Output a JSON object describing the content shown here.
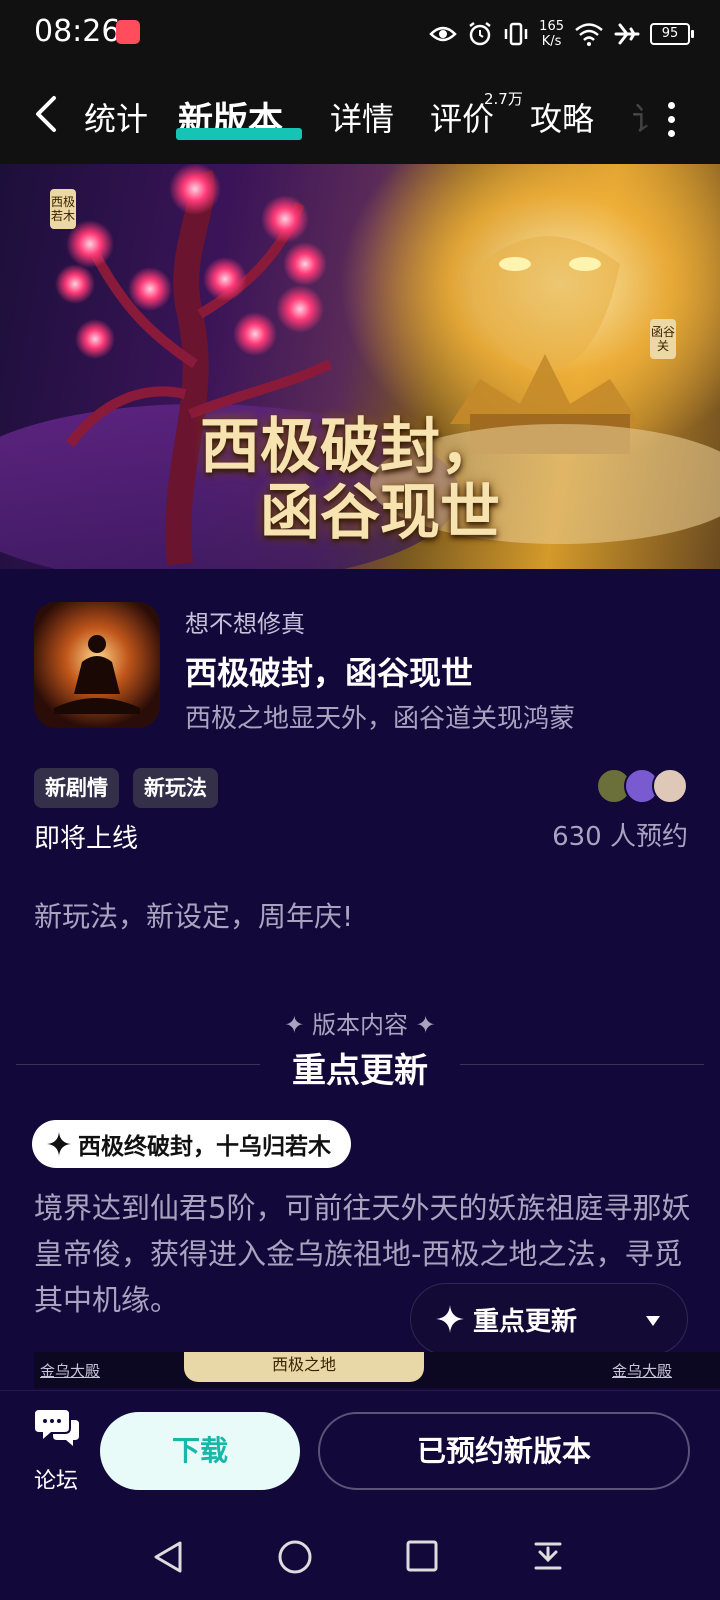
{
  "status_bar": {
    "time": "08:26",
    "net_speed_value": "165",
    "net_speed_unit": "K/s",
    "battery": "95"
  },
  "tabs": {
    "items": [
      "统计",
      "新版本",
      "详情",
      "评价",
      "攻略",
      "讠"
    ],
    "active_index": 1,
    "review_badge": "2.7万",
    "accent_color": "#16c4b4"
  },
  "banner": {
    "title_line1": "西极破封，",
    "title_line2": "函谷现世",
    "tag_left": "西极若木",
    "tag_right": "函谷关"
  },
  "version": {
    "game_name": "想不想修真",
    "title": "西极破封，函谷现世",
    "subtitle": "西极之地显天外，函谷道关现鸿蒙",
    "tags": [
      "新剧情",
      "新玩法"
    ],
    "status": "即将上线",
    "reserve_count": "630 人预约",
    "description": "新玩法，新设定，周年庆!"
  },
  "section": {
    "kicker": "✦ 版本内容 ✦",
    "title": "重点更新",
    "highlight_title": "西极终破封，十乌归若木",
    "body": "境界达到仙君5阶，可前往天外天的妖族祖庭寻那妖皇帝俊，获得进入金乌族祖地-西极之地之法，寻觅其中机缘。",
    "floating_menu_label": "重点更新"
  },
  "map_preview": {
    "left_label": "金乌大殿",
    "center_label": "西极之地",
    "right_label": "金乌大殿"
  },
  "bottom_bar": {
    "forum_label": "论坛",
    "download_label": "下载",
    "reserved_label": "已预约新版本"
  },
  "icons": {
    "back": "back-arrow-icon",
    "more": "more-vertical-icon",
    "sparkle": "sparkle-icon",
    "dropdown": "triangle-down-icon",
    "forum": "chat-bubbles-icon",
    "sys_back": "triangle-back-icon",
    "sys_home": "circle-home-icon",
    "sys_recents": "square-recents-icon",
    "sys_extra": "download-tray-icon"
  }
}
